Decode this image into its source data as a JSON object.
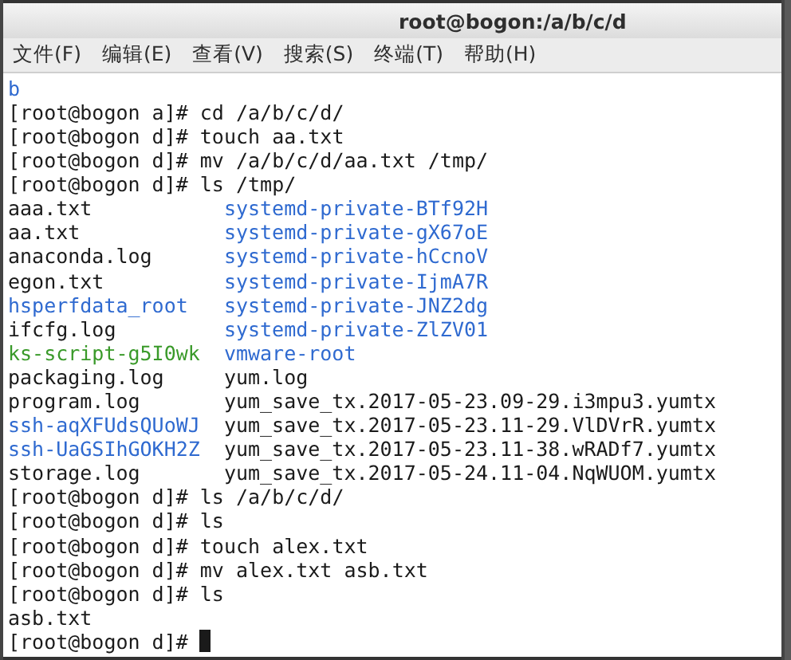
{
  "window": {
    "title": "root@bogon:/a/b/c/d"
  },
  "menu": [
    "文件(F)",
    "编辑(E)",
    "查看(V)",
    "搜索(S)",
    "终端(T)",
    "帮助(H)"
  ],
  "terminal": {
    "lines": [
      {
        "kind": "output",
        "text": "b",
        "color": "#2f6ad0"
      },
      {
        "kind": "prompt",
        "text": "[root@bogon a]# cd /a/b/c/d/"
      },
      {
        "kind": "prompt",
        "text": "[root@bogon d]# touch aa.txt"
      },
      {
        "kind": "prompt",
        "text": "[root@bogon d]# mv /a/b/c/d/aa.txt /tmp/"
      },
      {
        "kind": "prompt",
        "text": "[root@bogon d]# ls /tmp/"
      },
      {
        "kind": "columns",
        "cells": [
          {
            "text": "aaa.txt",
            "color": "#1a1a1a"
          },
          {
            "text": "systemd-private-BTf92H",
            "color": "#2f6ad0"
          }
        ]
      },
      {
        "kind": "columns",
        "cells": [
          {
            "text": "aa.txt",
            "color": "#1a1a1a"
          },
          {
            "text": "systemd-private-gX67oE",
            "color": "#2f6ad0"
          }
        ]
      },
      {
        "kind": "columns",
        "cells": [
          {
            "text": "anaconda.log",
            "color": "#1a1a1a"
          },
          {
            "text": "systemd-private-hCcnoV",
            "color": "#2f6ad0"
          }
        ]
      },
      {
        "kind": "columns",
        "cells": [
          {
            "text": "egon.txt",
            "color": "#1a1a1a"
          },
          {
            "text": "systemd-private-IjmA7R",
            "color": "#2f6ad0"
          }
        ]
      },
      {
        "kind": "columns",
        "cells": [
          {
            "text": "hsperfdata_root",
            "color": "#2f6ad0"
          },
          {
            "text": "systemd-private-JNZ2dg",
            "color": "#2f6ad0"
          }
        ]
      },
      {
        "kind": "columns",
        "cells": [
          {
            "text": "ifcfg.log",
            "color": "#1a1a1a"
          },
          {
            "text": "systemd-private-ZlZV01",
            "color": "#2f6ad0"
          }
        ]
      },
      {
        "kind": "columns",
        "cells": [
          {
            "text": "ks-script-g5I0wk",
            "color": "#3a9a2a"
          },
          {
            "text": "vmware-root",
            "color": "#2f6ad0"
          }
        ]
      },
      {
        "kind": "columns",
        "cells": [
          {
            "text": "packaging.log",
            "color": "#1a1a1a"
          },
          {
            "text": "yum.log",
            "color": "#1a1a1a"
          }
        ]
      },
      {
        "kind": "columns",
        "cells": [
          {
            "text": "program.log",
            "color": "#1a1a1a"
          },
          {
            "text": "yum_save_tx.2017-05-23.09-29.i3mpu3.yumtx",
            "color": "#1a1a1a"
          }
        ]
      },
      {
        "kind": "columns",
        "cells": [
          {
            "text": "ssh-aqXFUdsQUoWJ",
            "color": "#2f6ad0"
          },
          {
            "text": "yum_save_tx.2017-05-23.11-29.VlDVrR.yumtx",
            "color": "#1a1a1a"
          }
        ]
      },
      {
        "kind": "columns",
        "cells": [
          {
            "text": "ssh-UaGSIhGOKH2Z",
            "color": "#2f6ad0"
          },
          {
            "text": "yum_save_tx.2017-05-23.11-38.wRADf7.yumtx",
            "color": "#1a1a1a"
          }
        ]
      },
      {
        "kind": "columns",
        "cells": [
          {
            "text": "storage.log",
            "color": "#1a1a1a"
          },
          {
            "text": "yum_save_tx.2017-05-24.11-04.NqWUOM.yumtx",
            "color": "#1a1a1a"
          }
        ]
      },
      {
        "kind": "prompt",
        "text": "[root@bogon d]# ls /a/b/c/d/"
      },
      {
        "kind": "prompt",
        "text": "[root@bogon d]# ls"
      },
      {
        "kind": "prompt",
        "text": "[root@bogon d]# touch alex.txt"
      },
      {
        "kind": "prompt",
        "text": "[root@bogon d]# mv alex.txt asb.txt"
      },
      {
        "kind": "prompt",
        "text": "[root@bogon d]# ls"
      },
      {
        "kind": "output",
        "text": "asb.txt",
        "color": "#1a1a1a"
      },
      {
        "kind": "prompt",
        "text": "[root@bogon d]#",
        "cursor": true
      }
    ]
  }
}
